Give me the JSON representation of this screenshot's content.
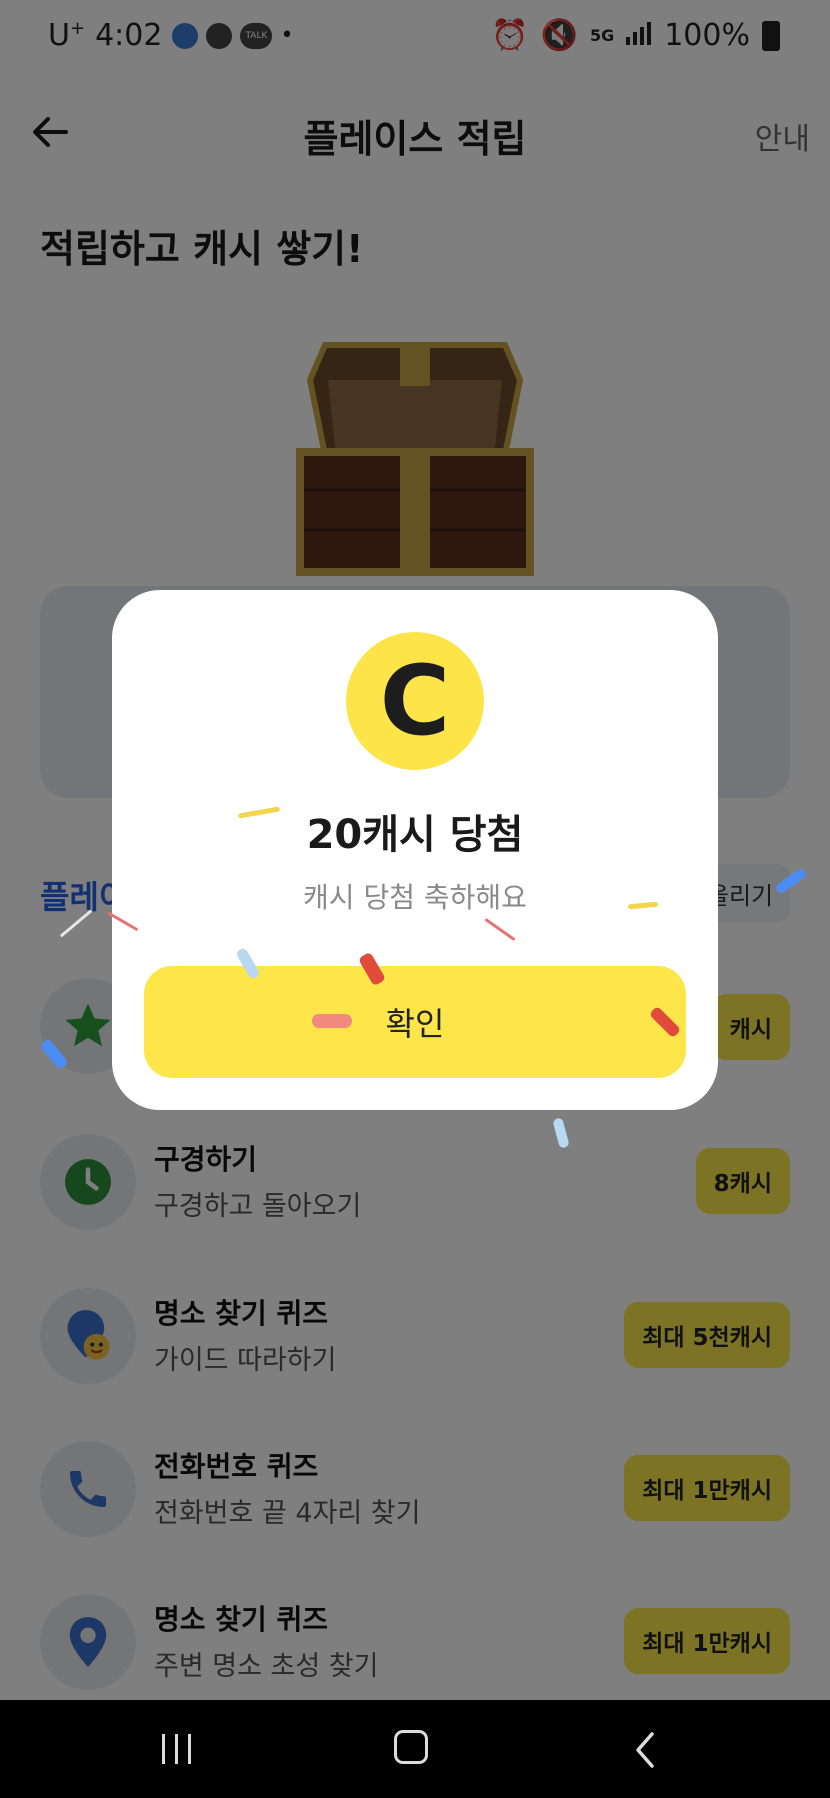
{
  "status_bar": {
    "carrier": "U",
    "carrier_sup": "+",
    "time": "4:02",
    "talk_label": "TALK",
    "network": "5G",
    "battery": "100%"
  },
  "header": {
    "title": "플레이스 적립",
    "guide_label": "안내"
  },
  "subtitle": "적립하고 캐시 쌓기!",
  "section": {
    "title_partial": "플레이",
    "sort_label": "올리기"
  },
  "missions": [
    {
      "title": "",
      "desc": "",
      "reward": "캐시",
      "icon": "star-icon"
    },
    {
      "title": "구경하기",
      "desc": "구경하고 돌아오기",
      "reward": "8캐시",
      "icon": "clock-icon"
    },
    {
      "title": "명소 찾기 퀴즈",
      "desc": "가이드 따라하기",
      "reward": "최대 5천캐시",
      "icon": "map-pin-smile-icon"
    },
    {
      "title": "전화번호 퀴즈",
      "desc": "전화번호 끝 4자리 찾기",
      "reward": "최대 1만캐시",
      "icon": "phone-icon"
    },
    {
      "title": "명소 찾기 퀴즈",
      "desc": "주변 명소 초성 찾기",
      "reward": "최대 1만캐시",
      "icon": "map-pin-icon"
    }
  ],
  "modal": {
    "coin_letter": "C",
    "title": "20캐시 당첨",
    "description": "캐시 당첨 축하해요",
    "confirm_label": "확인"
  },
  "colors": {
    "accent_yellow": "#fde54a",
    "coin_yellow": "#fce449",
    "section_blue": "#2563eb",
    "overlay": "rgba(0,0,0,0.5)"
  }
}
